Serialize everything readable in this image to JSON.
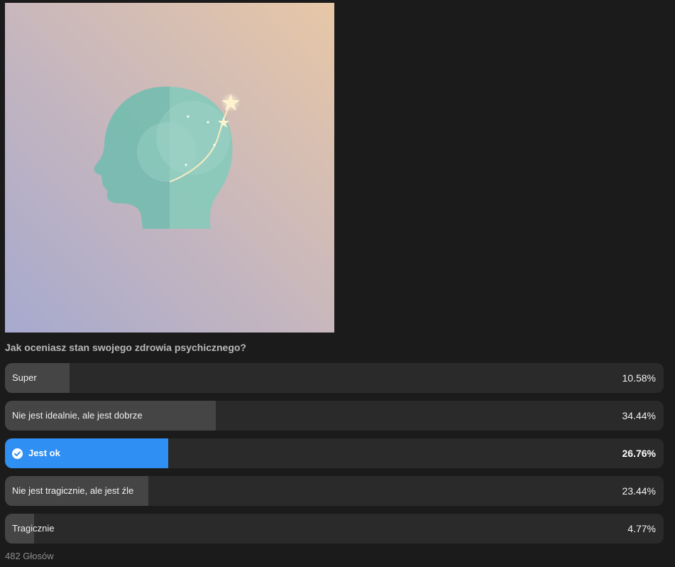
{
  "poll": {
    "image_alt": "head-illustration",
    "question": "Jak oceniasz stan swojego zdrowia psychicznego?",
    "options": [
      {
        "label": "Super",
        "percent_text": "10.58%",
        "fraction": 0.1058,
        "selected": false
      },
      {
        "label": "Nie jest idealnie, ale jest dobrze",
        "percent_text": "34.44%",
        "fraction": 0.3444,
        "selected": false
      },
      {
        "label": "Jest ok",
        "percent_text": "26.76%",
        "fraction": 0.2676,
        "selected": true
      },
      {
        "label": "Nie jest tragicznie, ale jest źle",
        "percent_text": "23.44%",
        "fraction": 0.2344,
        "selected": false
      },
      {
        "label": "Tragicznie",
        "percent_text": "4.77%",
        "fraction": 0.0477,
        "selected": false
      }
    ],
    "votes_text": "482 Głosów",
    "colors": {
      "background": "#1b1b1b",
      "bar_track": "#2a2a2a",
      "bar_fill": "#454545",
      "selected_fill": "#2f8ff3"
    }
  }
}
